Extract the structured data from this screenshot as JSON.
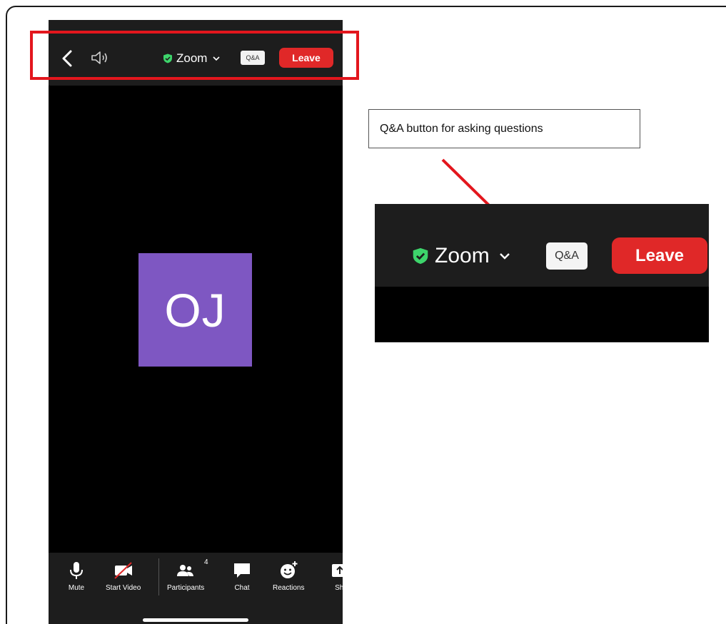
{
  "phone": {
    "topbar": {
      "meeting_title": "Zoom",
      "qa_label": "Q&A",
      "leave_label": "Leave"
    },
    "participant": {
      "initials": "OJ",
      "avatar_color": "#7e57c2"
    },
    "toolbar": {
      "items": [
        {
          "label": "Mute",
          "icon": "microphone-icon"
        },
        {
          "label": "Start Video",
          "icon": "video-off-icon"
        },
        {
          "label": "Participants",
          "icon": "participants-icon",
          "badge": "4"
        },
        {
          "label": "Chat",
          "icon": "chat-icon"
        },
        {
          "label": "Reactions",
          "icon": "reactions-icon"
        },
        {
          "label": "Sha",
          "icon": "share-icon"
        }
      ]
    }
  },
  "callout": {
    "text": "Q&A button for asking questions"
  },
  "zoomed": {
    "meeting_title": "Zoom",
    "qa_label": "Q&A",
    "leave_label": "Leave"
  },
  "colors": {
    "leave": "#e02828",
    "highlight": "#e3161d",
    "shield": "#3dd46b",
    "toolbar_bg": "#1d1d1d"
  }
}
